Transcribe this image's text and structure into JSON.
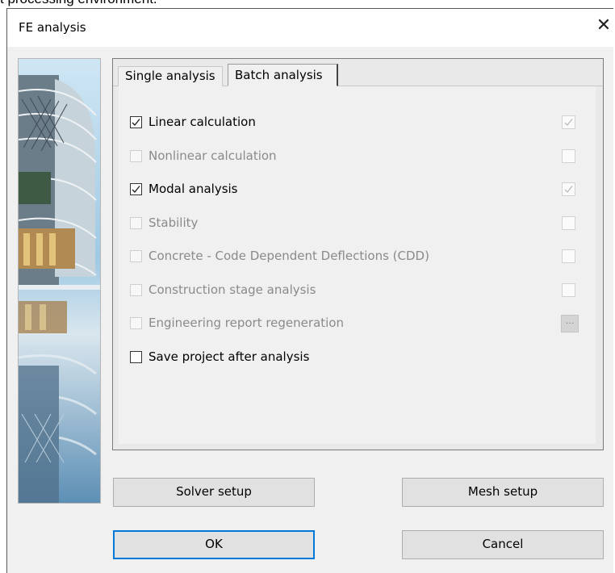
{
  "background_caption": "t processing environment.",
  "dialog": {
    "title": "FE analysis",
    "close_symbol": "✕"
  },
  "tabs": [
    {
      "label": "Single analysis",
      "active": false
    },
    {
      "label": "Batch analysis",
      "active": true
    }
  ],
  "options": [
    {
      "label": "Linear calculation",
      "checked": true,
      "enabled": true,
      "right": "check"
    },
    {
      "label": "Nonlinear calculation",
      "checked": false,
      "enabled": false,
      "right": "box"
    },
    {
      "label": "Modal analysis",
      "checked": true,
      "enabled": true,
      "right": "check"
    },
    {
      "label": "Stability",
      "checked": false,
      "enabled": false,
      "right": "box"
    },
    {
      "label": "Concrete - Code Dependent Deflections (CDD)",
      "checked": false,
      "enabled": false,
      "right": "box"
    },
    {
      "label": "Construction stage analysis",
      "checked": false,
      "enabled": false,
      "right": "box"
    },
    {
      "label": "Engineering report regeneration",
      "checked": false,
      "enabled": false,
      "right": "dots"
    },
    {
      "label": "Save project after analysis",
      "checked": false,
      "enabled": true,
      "right": "none"
    }
  ],
  "dots_label": "...",
  "buttons": {
    "solver_setup": "Solver setup",
    "mesh_setup": "Mesh setup",
    "ok": "OK",
    "cancel": "Cancel"
  },
  "colors": {
    "accent": "#0078d7",
    "dialog_bg": "#f0f0f0"
  }
}
